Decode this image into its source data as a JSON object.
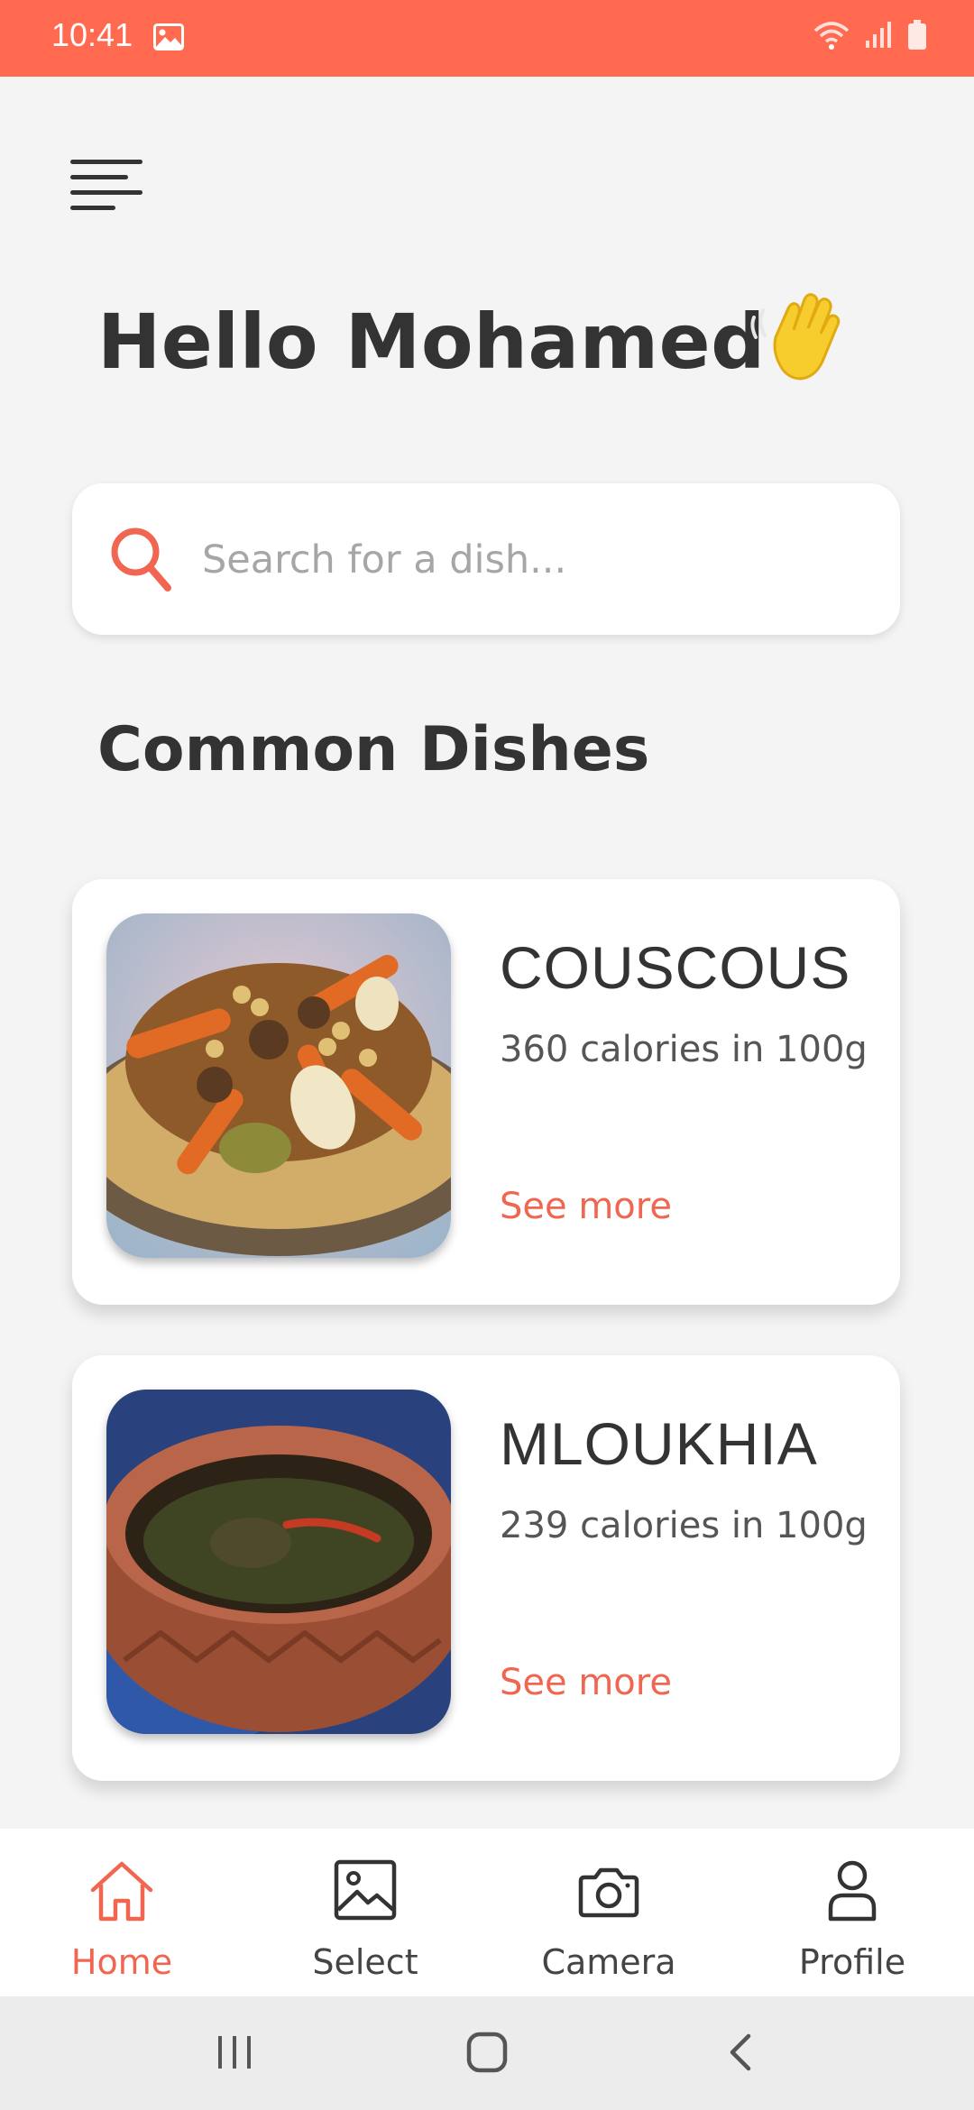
{
  "status_bar": {
    "time": "10:41",
    "icons": [
      "image-icon",
      "wifi-icon",
      "signal-icon",
      "battery-icon"
    ],
    "color": "#ff6a50"
  },
  "header": {
    "menu_icon": "hamburger-menu-icon",
    "greeting": "Hello Mohamed",
    "greeting_emoji": "waving-hand-icon"
  },
  "search": {
    "placeholder": "Search for a dish...",
    "icon": "search-icon",
    "icon_color": "#f06650"
  },
  "section": {
    "title": "Common Dishes"
  },
  "dishes": [
    {
      "name": "COUSCOUS",
      "calories": "360 calories in 100g",
      "action": "See more",
      "image": "couscous-photo"
    },
    {
      "name": "MLOUKHIA",
      "calories": "239 calories in 100g",
      "action": "See more",
      "image": "mloukhia-photo"
    }
  ],
  "bottom_nav": {
    "items": [
      {
        "label": "Home",
        "icon": "home-icon",
        "active": true
      },
      {
        "label": "Select",
        "icon": "gallery-icon",
        "active": false
      },
      {
        "label": "Camera",
        "icon": "camera-icon",
        "active": false
      },
      {
        "label": "Profile",
        "icon": "profile-icon",
        "active": false
      }
    ],
    "active_color": "#f06650"
  },
  "system_nav": {
    "buttons": [
      "recent-apps-icon",
      "home-circle-icon",
      "back-icon"
    ]
  }
}
